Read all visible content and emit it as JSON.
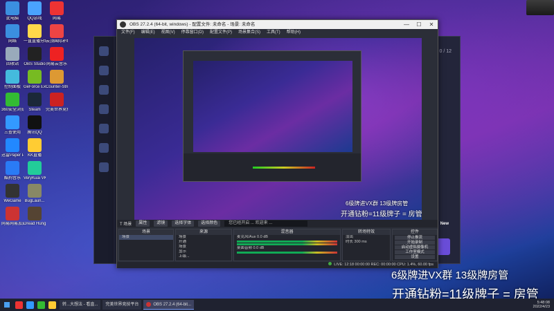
{
  "desktop": {
    "icons": [
      {
        "label": "此电脑",
        "color": "#3b8fe0"
      },
      {
        "label": "QQ游戏",
        "color": "#4aa3ff"
      },
      {
        "label": "网易",
        "color": "#e33"
      },
      {
        "label": "网络",
        "color": "#3b8fe0"
      },
      {
        "label": "一直直播分组",
        "color": "#ffd84a"
      },
      {
        "label": "云顶国际补给",
        "color": "#e44"
      },
      {
        "label": "回收站",
        "color": "#9ab"
      },
      {
        "label": "OBS Studio",
        "color": "#222"
      },
      {
        "label": "网易云音乐",
        "color": "#e22"
      },
      {
        "label": "控制面板",
        "color": "#4bd"
      },
      {
        "label": "GeForce Experience",
        "color": "#7b2"
      },
      {
        "label": "Counter-Strike Global Off...",
        "color": "#d93"
      },
      {
        "label": "360安全浏览器",
        "color": "#3b3"
      },
      {
        "label": "Steam",
        "color": "#1b2838"
      },
      {
        "label": "完美世界竞技平台",
        "color": "#c22"
      },
      {
        "label": "三查使用",
        "color": "#39f"
      },
      {
        "label": "腾讯QQ",
        "color": "#111"
      },
      {
        "label": "",
        "color": "transparent"
      },
      {
        "label": "迅雷Paper Playback",
        "color": "#28f"
      },
      {
        "label": "KK直播",
        "color": "#fc3"
      },
      {
        "label": "",
        "color": "transparent"
      },
      {
        "label": "酷狗音乐",
        "color": "#2a7bf5"
      },
      {
        "label": "VeryKuai VK 加速器",
        "color": "#2c9"
      },
      {
        "label": "",
        "color": "transparent"
      },
      {
        "label": "WeGame",
        "color": "#333"
      },
      {
        "label": "BugLaun...",
        "color": "#886"
      },
      {
        "label": "",
        "color": "transparent"
      },
      {
        "label": "网易网易加速器",
        "color": "#c33"
      },
      {
        "label": "Dread Hunger",
        "color": "#543"
      }
    ]
  },
  "obs": {
    "title": "OBS 27.2.4 (64-bit, windows) - 配置文件: 未命名 - 场景: 未命名",
    "window_controls": [
      "—",
      "☐",
      "✕"
    ],
    "menu": [
      "文件(F)",
      "编辑(E)",
      "视图(V)",
      "停靠窗口(D)",
      "配置文件(P)",
      "场景集合(S)",
      "工具(T)",
      "帮助(H)"
    ],
    "source_toolbar": {
      "source": "T 场景",
      "props": "属性",
      "filters": "滤镜",
      "select_font": "选择字体",
      "select_color": "选择颜色",
      "text_prefix": "您已经开启 ...",
      "text_value": "欢迎来 ..."
    },
    "docks": {
      "scenes": {
        "header": "场景",
        "items": [
          "场景"
        ]
      },
      "sources": {
        "header": "来源",
        "items": [
          "场景",
          "开通",
          "场景",
          "显示",
          "上级...",
          "捕捉"
        ]
      },
      "mixer": {
        "header": "混音器",
        "items": [
          "麦克风/Aux",
          "桌面音频"
        ],
        "levels": [
          "0.0 dB",
          "0.0 dB"
        ]
      },
      "transitions": {
        "header": "转场特效",
        "type": "淡出",
        "duration_label": "时长",
        "duration": "300 ms"
      },
      "controls": {
        "header": "控件",
        "buttons": [
          "停止推流",
          "开始录制",
          "启动虚拟摄像机",
          "工作室模式",
          "设置",
          "退出"
        ]
      }
    },
    "status": "LIVE: 12:18  00:00:00  REC: 00:00:00  CPU: 1.4%, 60.00 fps"
  },
  "preview_overlay": {
    "line1": "6级牌进VX群  13级牌房管",
    "line2": "开通钻粉=11级牌子 = 房管"
  },
  "overlay": {
    "line1": "6级牌进VX群  13级牌房管",
    "line2": "开通钻粉=11级牌子 = 房管"
  },
  "back_app": {
    "page": "0 / 12",
    "badge": "New"
  },
  "taskbar": {
    "tasks": [
      {
        "label": "转...大想法 - 看直...",
        "active": false
      },
      {
        "label": "完美世界竞技平台",
        "active": false
      },
      {
        "label": "OBS 27.2.4 (64-bit...",
        "active": true
      }
    ],
    "time": "5:48:08",
    "date": "2022/4/23"
  }
}
